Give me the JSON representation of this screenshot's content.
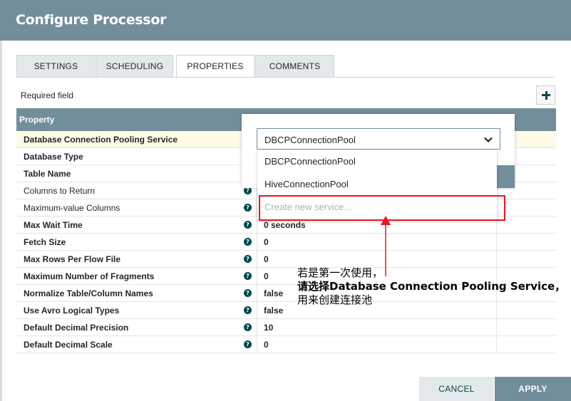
{
  "dialog": {
    "title": "Configure Processor"
  },
  "tabs": [
    {
      "label": "SETTINGS"
    },
    {
      "label": "SCHEDULING"
    },
    {
      "label": "PROPERTIES"
    },
    {
      "label": "COMMENTS"
    }
  ],
  "required_label": "Required field",
  "add_icon": "plus-icon",
  "table": {
    "header": "Property",
    "rows": [
      {
        "name": "Database Connection Pooling Service",
        "value": "",
        "bold": true
      },
      {
        "name": "Database Type",
        "value": "",
        "bold": true
      },
      {
        "name": "Table Name",
        "value": "",
        "bold": true
      },
      {
        "name": "Columns to Return",
        "value": "",
        "bold": false
      },
      {
        "name": "Maximum-value Columns",
        "value": "",
        "bold": false
      },
      {
        "name": "Max Wait Time",
        "value": "0 seconds",
        "bold": true
      },
      {
        "name": "Fetch Size",
        "value": "0",
        "bold": true
      },
      {
        "name": "Max Rows Per Flow File",
        "value": "0",
        "bold": true
      },
      {
        "name": "Maximum Number of Fragments",
        "value": "0",
        "bold": true
      },
      {
        "name": "Normalize Table/Column Names",
        "value": "false",
        "bold": true
      },
      {
        "name": "Use Avro Logical Types",
        "value": "false",
        "bold": true
      },
      {
        "name": "Default Decimal Precision",
        "value": "10",
        "bold": true
      },
      {
        "name": "Default Decimal Scale",
        "value": "0",
        "bold": true
      }
    ]
  },
  "dropdown": {
    "selected": "DBCPConnectionPool",
    "options": [
      "DBCPConnectionPool",
      "HiveConnectionPool"
    ],
    "create_placeholder": "Create new service..."
  },
  "annotation": {
    "line1": "若是第一次使用，",
    "line2": "请选择Database Connection Pooling Service，",
    "line3": "用来创建连接池",
    "color": "#e8161c"
  },
  "buttons": {
    "cancel": "CANCEL",
    "apply": "APPLY"
  },
  "colors": {
    "header": "#728e9b",
    "accent": "#004849",
    "highlight_row": "#fffbe6"
  }
}
